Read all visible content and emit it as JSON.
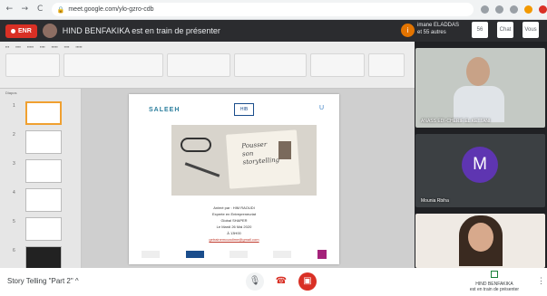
{
  "browser": {
    "back": "←",
    "forward": "→",
    "reload": "C",
    "url": "meet.google.com/ylo-gzro-cdb"
  },
  "meet": {
    "rec_label": "ENR",
    "presenting_text": "HIND BENFAKIKA est en train de présenter",
    "people_initial": "i",
    "people_line1": "imane ELADDAS",
    "people_line2": "et 55 autres",
    "chat_label": "Chat",
    "you_label": "Vous"
  },
  "slides_panel": {
    "tabs": "Diapos",
    "thumbnails": [
      {
        "num": "1"
      },
      {
        "num": "2"
      },
      {
        "num": "3"
      },
      {
        "num": "4"
      },
      {
        "num": "5"
      },
      {
        "num": "6"
      }
    ]
  },
  "slide": {
    "logo_left": "SALEEH",
    "logo_mid": "HIB",
    "logo_right": "U",
    "hero_line1": "Pousser",
    "hero_line2": "son",
    "hero_line3": "storytelling",
    "line1": "Animé par :      HIM  RAOUDI",
    "line2": "Experte en Entrepreneuriat",
    "line3": "Global SHAPER",
    "line4": "Le Mardi 26 Mai 2020",
    "line5": "À 13H00",
    "email": "getrainemcoadime@gmail.com"
  },
  "participants": [
    {
      "name": "ANASS EDI-CHERIF EL KETTANI"
    },
    {
      "name": "Mounia Rbiha",
      "initial": "M"
    },
    {
      "name": ""
    }
  ],
  "bottom": {
    "meeting_title": "Story Telling \"Part 2\"",
    "chevron": "^",
    "mic": "🎙",
    "hangup": "☎",
    "camera": "▣",
    "presenter_line1": "HIND BENFAKIKA",
    "presenter_line2": "est en train de présenter",
    "more": "⋮"
  },
  "colors": {
    "record_red": "#d93025",
    "avatar_purple": "#5e35b1",
    "brand_teal": "#2a7d9c"
  }
}
